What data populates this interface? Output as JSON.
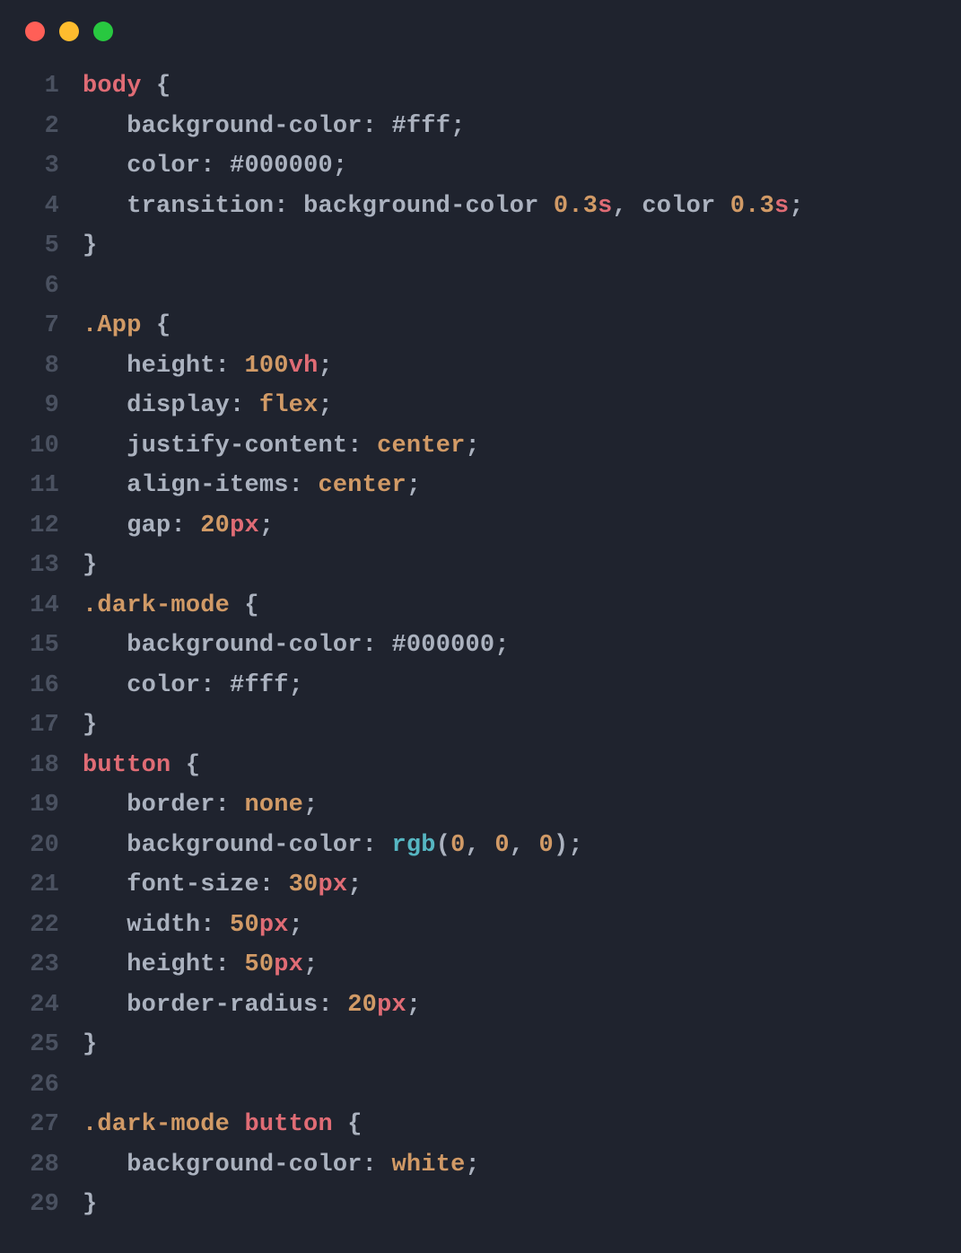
{
  "window": {
    "buttons": {
      "close": "red",
      "minimize": "yellow",
      "zoom": "green"
    }
  },
  "code": {
    "lines": [
      {
        "n": "1",
        "t": [
          [
            "sel",
            "body"
          ],
          [
            "punc",
            " {"
          ]
        ]
      },
      {
        "n": "2",
        "t": [
          [
            "indent",
            "   "
          ],
          [
            "prop",
            "background-color"
          ],
          [
            "punc",
            ": "
          ],
          [
            "hash",
            "#"
          ],
          [
            "hex",
            "fff"
          ],
          [
            "punc",
            ";"
          ]
        ]
      },
      {
        "n": "3",
        "t": [
          [
            "indent",
            "   "
          ],
          [
            "prop",
            "color"
          ],
          [
            "punc",
            ": "
          ],
          [
            "hash",
            "#"
          ],
          [
            "hex",
            "000000"
          ],
          [
            "punc",
            ";"
          ]
        ]
      },
      {
        "n": "4",
        "t": [
          [
            "indent",
            "   "
          ],
          [
            "prop",
            "transition"
          ],
          [
            "punc",
            ": "
          ],
          [
            "prop",
            "background-color "
          ],
          [
            "num",
            "0.3"
          ],
          [
            "unit",
            "s"
          ],
          [
            "punc",
            ", "
          ],
          [
            "prop",
            "color "
          ],
          [
            "num",
            "0.3"
          ],
          [
            "unit",
            "s"
          ],
          [
            "punc",
            ";"
          ]
        ]
      },
      {
        "n": "5",
        "t": [
          [
            "punc",
            "}"
          ]
        ]
      },
      {
        "n": "6",
        "t": []
      },
      {
        "n": "7",
        "t": [
          [
            "class",
            ".App"
          ],
          [
            "punc",
            " {"
          ]
        ]
      },
      {
        "n": "8",
        "t": [
          [
            "indent",
            "   "
          ],
          [
            "prop",
            "height"
          ],
          [
            "punc",
            ": "
          ],
          [
            "num",
            "100"
          ],
          [
            "unit",
            "vh"
          ],
          [
            "punc",
            ";"
          ]
        ]
      },
      {
        "n": "9",
        "t": [
          [
            "indent",
            "   "
          ],
          [
            "prop",
            "display"
          ],
          [
            "punc",
            ": "
          ],
          [
            "kw",
            "flex"
          ],
          [
            "punc",
            ";"
          ]
        ]
      },
      {
        "n": "10",
        "t": [
          [
            "indent",
            "   "
          ],
          [
            "prop",
            "justify-content"
          ],
          [
            "punc",
            ": "
          ],
          [
            "kw",
            "center"
          ],
          [
            "punc",
            ";"
          ]
        ]
      },
      {
        "n": "11",
        "t": [
          [
            "indent",
            "   "
          ],
          [
            "prop",
            "align-items"
          ],
          [
            "punc",
            ": "
          ],
          [
            "kw",
            "center"
          ],
          [
            "punc",
            ";"
          ]
        ]
      },
      {
        "n": "12",
        "t": [
          [
            "indent",
            "   "
          ],
          [
            "prop",
            "gap"
          ],
          [
            "punc",
            ": "
          ],
          [
            "num",
            "20"
          ],
          [
            "unit",
            "px"
          ],
          [
            "punc",
            ";"
          ]
        ]
      },
      {
        "n": "13",
        "t": [
          [
            "punc",
            "}"
          ]
        ]
      },
      {
        "n": "14",
        "t": [
          [
            "class",
            ".dark-mode"
          ],
          [
            "punc",
            " {"
          ]
        ]
      },
      {
        "n": "15",
        "t": [
          [
            "indent",
            "   "
          ],
          [
            "prop",
            "background-color"
          ],
          [
            "punc",
            ": "
          ],
          [
            "hash",
            "#"
          ],
          [
            "hex",
            "000000"
          ],
          [
            "punc",
            ";"
          ]
        ]
      },
      {
        "n": "16",
        "t": [
          [
            "indent",
            "   "
          ],
          [
            "prop",
            "color"
          ],
          [
            "punc",
            ": "
          ],
          [
            "hash",
            "#"
          ],
          [
            "hex",
            "fff"
          ],
          [
            "punc",
            ";"
          ]
        ]
      },
      {
        "n": "17",
        "t": [
          [
            "punc",
            "}"
          ]
        ]
      },
      {
        "n": "18",
        "t": [
          [
            "sel",
            "button"
          ],
          [
            "punc",
            " {"
          ]
        ]
      },
      {
        "n": "19",
        "t": [
          [
            "indent",
            "   "
          ],
          [
            "prop",
            "border"
          ],
          [
            "punc",
            ": "
          ],
          [
            "kw",
            "none"
          ],
          [
            "punc",
            ";"
          ]
        ]
      },
      {
        "n": "20",
        "t": [
          [
            "indent",
            "   "
          ],
          [
            "prop",
            "background-color"
          ],
          [
            "punc",
            ": "
          ],
          [
            "func",
            "rgb"
          ],
          [
            "punc",
            "("
          ],
          [
            "num",
            "0"
          ],
          [
            "punc",
            ", "
          ],
          [
            "num",
            "0"
          ],
          [
            "punc",
            ", "
          ],
          [
            "num",
            "0"
          ],
          [
            "punc",
            ")"
          ],
          [
            "punc",
            ";"
          ]
        ]
      },
      {
        "n": "21",
        "t": [
          [
            "indent",
            "   "
          ],
          [
            "prop",
            "font-size"
          ],
          [
            "punc",
            ": "
          ],
          [
            "num",
            "30"
          ],
          [
            "unit",
            "px"
          ],
          [
            "punc",
            ";"
          ]
        ]
      },
      {
        "n": "22",
        "t": [
          [
            "indent",
            "   "
          ],
          [
            "prop",
            "width"
          ],
          [
            "punc",
            ": "
          ],
          [
            "num",
            "50"
          ],
          [
            "unit",
            "px"
          ],
          [
            "punc",
            ";"
          ]
        ]
      },
      {
        "n": "23",
        "t": [
          [
            "indent",
            "   "
          ],
          [
            "prop",
            "height"
          ],
          [
            "punc",
            ": "
          ],
          [
            "num",
            "50"
          ],
          [
            "unit",
            "px"
          ],
          [
            "punc",
            ";"
          ]
        ]
      },
      {
        "n": "24",
        "t": [
          [
            "indent",
            "   "
          ],
          [
            "prop",
            "border-radius"
          ],
          [
            "punc",
            ": "
          ],
          [
            "num",
            "20"
          ],
          [
            "unit",
            "px"
          ],
          [
            "punc",
            ";"
          ]
        ]
      },
      {
        "n": "25",
        "t": [
          [
            "punc",
            "}"
          ]
        ]
      },
      {
        "n": "26",
        "t": []
      },
      {
        "n": "27",
        "t": [
          [
            "class",
            ".dark-mode "
          ],
          [
            "sel",
            "button"
          ],
          [
            "punc",
            " {"
          ]
        ]
      },
      {
        "n": "28",
        "t": [
          [
            "indent",
            "   "
          ],
          [
            "prop",
            "background-color"
          ],
          [
            "punc",
            ": "
          ],
          [
            "kw",
            "white"
          ],
          [
            "punc",
            ";"
          ]
        ]
      },
      {
        "n": "29",
        "t": [
          [
            "punc",
            "}"
          ]
        ]
      }
    ]
  }
}
